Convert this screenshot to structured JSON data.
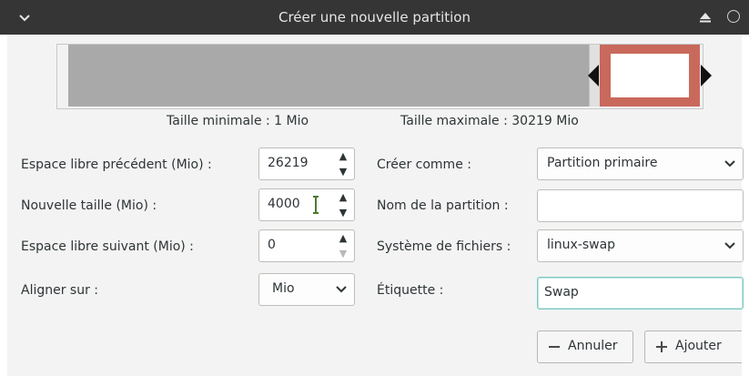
{
  "window": {
    "title": "Créer une nouvelle partition",
    "icons": [
      "chevron-down-icon",
      "eject-icon",
      "close-circle-icon"
    ]
  },
  "visual": {
    "min_size_label": "Taille minimale : 1 Mio",
    "max_size_label": "Taille maximale : 30219 Mio",
    "colors": {
      "free": "#a9a9a9",
      "partition": "#c8695b",
      "partition_fill": "#ffffff"
    }
  },
  "left": {
    "free_before": {
      "label": "Espace libre précédent (Mio) :",
      "value": "26219"
    },
    "new_size": {
      "label": "Nouvelle taille (Mio) :",
      "value": "4000"
    },
    "free_after": {
      "label": "Espace libre suivant (Mio) :",
      "value": "0"
    },
    "align": {
      "label": "Aligner sur :",
      "value": "Mio"
    }
  },
  "right": {
    "create_as": {
      "label": "Créer comme :",
      "value": "Partition primaire"
    },
    "partition_name": {
      "label": "Nom de la partition :",
      "value": ""
    },
    "filesystem": {
      "label": "Système de fichiers :",
      "value": "linux-swap"
    },
    "fs_label": {
      "label": "Étiquette :",
      "value": "Swap"
    }
  },
  "buttons": {
    "cancel": "Annuler",
    "add": "Ajouter"
  },
  "accent": {
    "focus_border": "#7ec9c2",
    "titlebar": "#353535"
  }
}
